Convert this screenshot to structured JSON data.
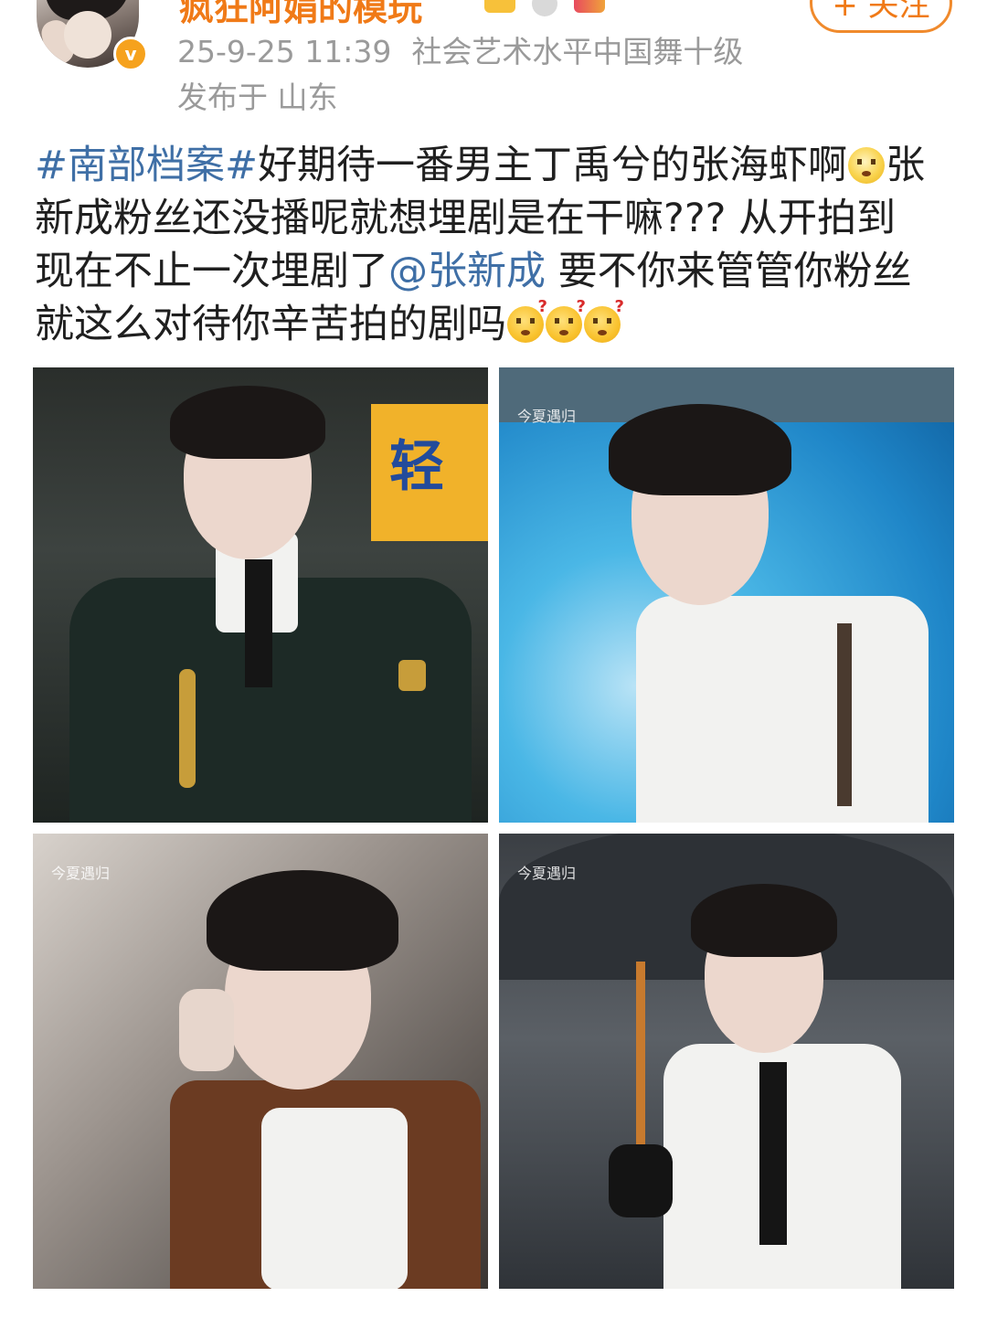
{
  "post": {
    "author": {
      "name": "疯狂阿娟的模玩",
      "verified_badge": "v"
    },
    "follow_label": "+ 关注",
    "timestamp": "25-9-25 11:39",
    "source": "社会艺术水平中国舞十级",
    "location": "发布于 山东",
    "text": {
      "hashtag": "#南部档案#",
      "line1_rest": "好期待一番男主丁禹兮的张海虾啊",
      "line1_tail": "张",
      "line2": "新成粉丝还没播呢就想埋剧是在干嘛???  从开拍到",
      "line3_pre": "现在不止一次埋剧了",
      "mention": "@张新成",
      "line3_post": " 要不你来管管你粉丝",
      "line4": "就这么对待你辛苦拍的剧吗"
    },
    "photos": {
      "p1_sign_text": "轻",
      "watermark": "今夏遇归"
    }
  },
  "colors": {
    "username": "#f07a17",
    "link": "#3f6fa6",
    "meta": "#9a9a9a",
    "verified": "#f6a21d"
  },
  "icons": [
    "verified-badge-icon",
    "dizzy-face-emoji",
    "confused-face-emoji"
  ]
}
